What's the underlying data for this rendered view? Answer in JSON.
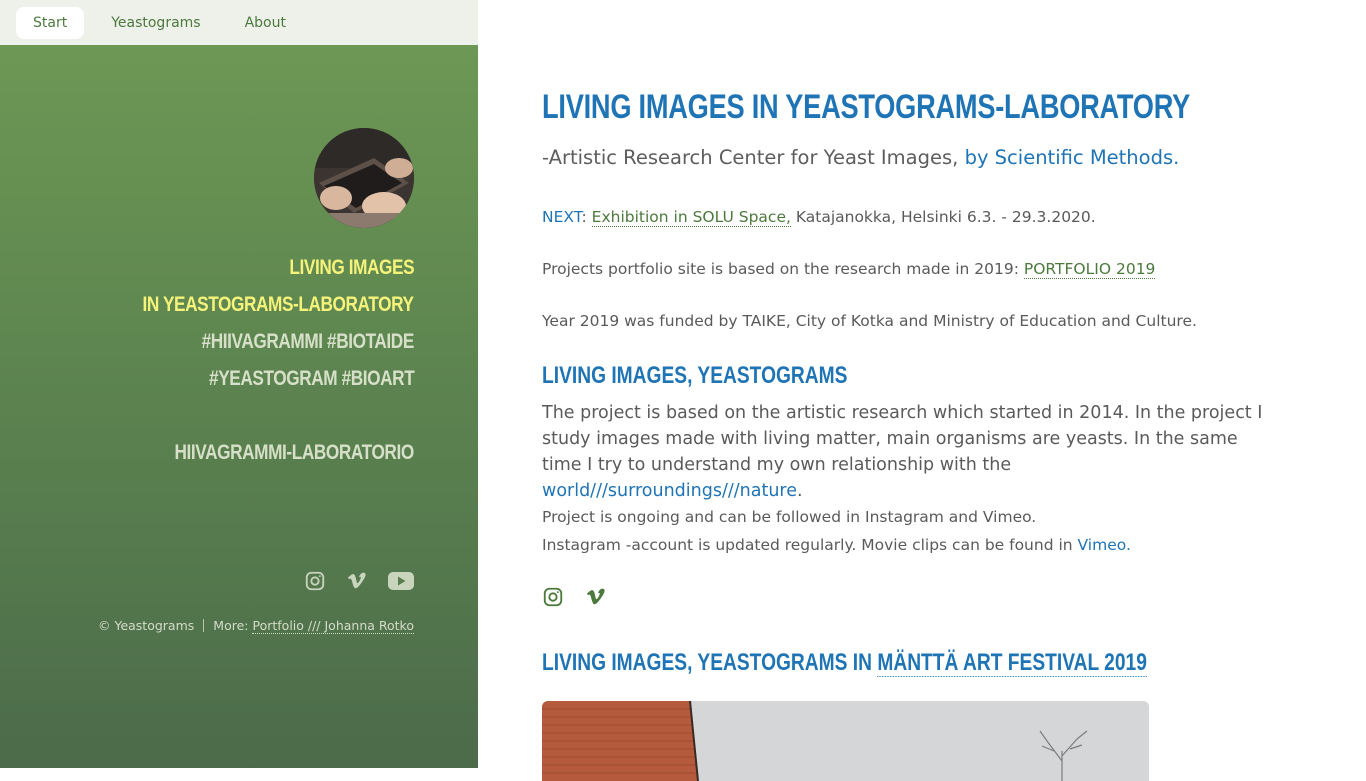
{
  "nav": {
    "items": [
      {
        "label": "Start",
        "active": true
      },
      {
        "label": "Yeastograms",
        "active": false
      },
      {
        "label": "About",
        "active": false
      }
    ]
  },
  "sidebar": {
    "title_line1": "LIVING IMAGES",
    "title_line2": "IN YEASTOGRAMS-LABORATORY",
    "tags_line1": "#HIIVAGRAMMI #BIOTAIDE",
    "tags_line2": "#YEASTOGRAM #BIOART",
    "lab_name": "HIIVAGRAMMI-LABORATORIO",
    "icons": [
      "instagram-icon",
      "vimeo-icon",
      "youtube-icon"
    ],
    "copyright": "© Yeastograms",
    "more_label": "More:",
    "more_link": "Portfolio /// Johanna Rotko"
  },
  "main": {
    "title": "LIVING IMAGES IN YEASTOGRAMS-LABORATORY",
    "subtitle_text": "-Artistic Research Center for Yeast Images, ",
    "subtitle_link": "by Scientific Methods",
    "subtitle_end": ".",
    "next_label": "NEXT",
    "next_colon": ": ",
    "next_link": "Exhibition in SOLU Space,",
    "next_rest": " Katajanokka, Helsinki 6.3. - 29.3.2020.",
    "portfolio_text": "Projects portfolio site is based on the research made in 2019: ",
    "portfolio_link": "PORTFOLIO 2019",
    "funding_text": "Year 2019 was funded by TAIKE, City of Kotka and Ministry of Education and Culture.",
    "section1_title": "LIVING IMAGES, YEASTOGRAMS",
    "section1_body": "The project is based on the artistic research which started in 2014. In the project I study images made with living matter, main organisms are yeasts. In the same time I try to understand my own relationship with the ",
    "section1_link": "world///surroundings///nature",
    "section1_end": ".",
    "follow_line1": "Project is ongoing and can be followed in Instagram and Vimeo.",
    "follow_line2_text": "Instagram -account is updated regularly. Movie clips can be found in ",
    "follow_line2_link": "Vimeo",
    "follow_line2_end": ".",
    "social_icons": [
      "instagram-icon",
      "vimeo-icon"
    ],
    "section2_title_text": "LIVING IMAGES, YEASTOGRAMS IN ",
    "section2_title_link": "MÄNTTÄ ART FESTIVAL 2019"
  },
  "colors": {
    "accent_blue": "#1e74b5",
    "link_green": "#4c7a3c",
    "sidebar_yellow": "#f5f37a",
    "sidebar_green": "#5e8650"
  }
}
